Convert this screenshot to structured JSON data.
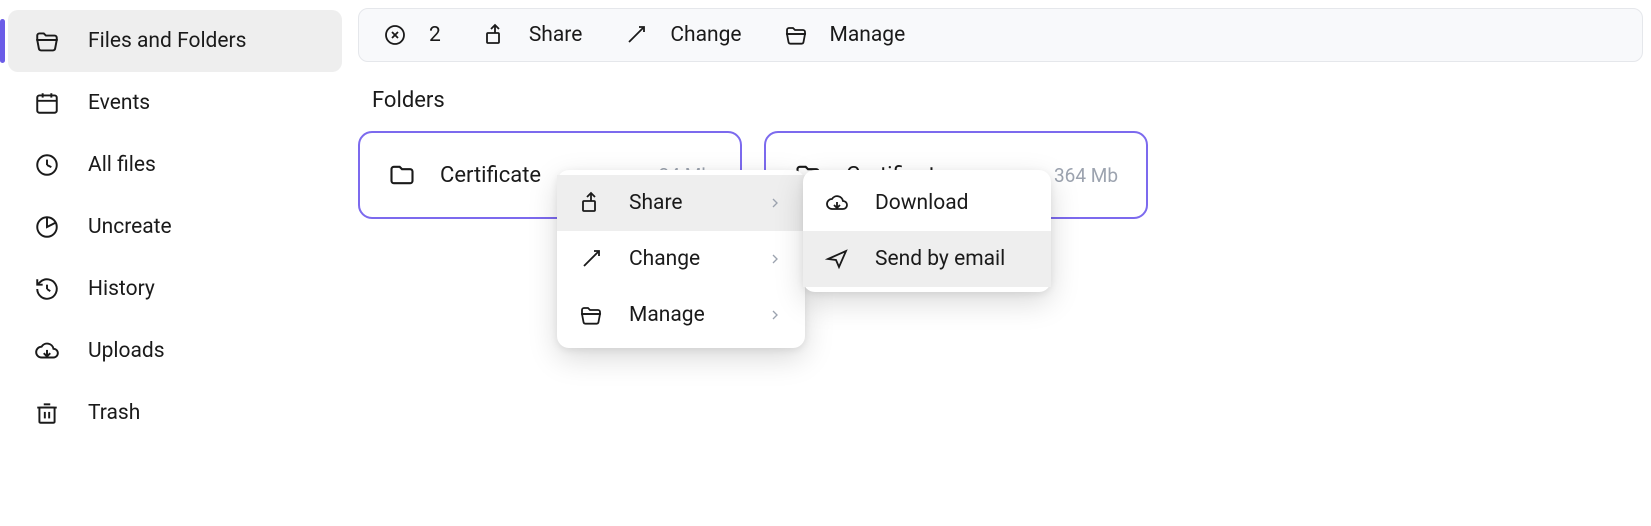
{
  "sidebar": {
    "items": [
      {
        "label": "Files and Folders",
        "icon": "folder-open"
      },
      {
        "label": "Events",
        "icon": "calendar"
      },
      {
        "label": "All files",
        "icon": "clock"
      },
      {
        "label": "Uncreate",
        "icon": "pie"
      },
      {
        "label": "History",
        "icon": "history"
      },
      {
        "label": "Uploads",
        "icon": "cloud-download"
      },
      {
        "label": "Trash",
        "icon": "trash"
      }
    ]
  },
  "toolbar": {
    "count": "2",
    "share": "Share",
    "change": "Change",
    "manage": "Manage"
  },
  "section_title": "Folders",
  "folders": [
    {
      "name": "Certificate",
      "size": "34 Mb"
    },
    {
      "name": "Certificate",
      "size": "364 Mb"
    }
  ],
  "context_menu_1": {
    "items": [
      {
        "label": "Share",
        "icon": "share",
        "has_sub": true
      },
      {
        "label": "Change",
        "icon": "pencil",
        "has_sub": true
      },
      {
        "label": "Manage",
        "icon": "folder-open",
        "has_sub": true
      }
    ]
  },
  "context_menu_2": {
    "items": [
      {
        "label": "Download",
        "icon": "cloud-download"
      },
      {
        "label": "Send by email",
        "icon": "send"
      }
    ]
  }
}
